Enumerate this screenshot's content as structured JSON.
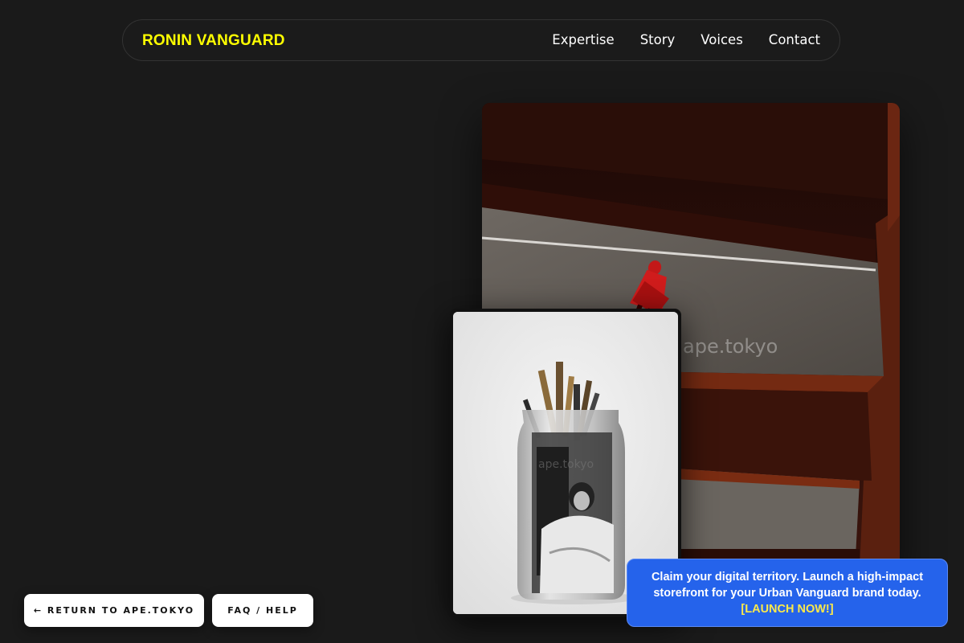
{
  "header": {
    "brand": "RONIN VANGUARD",
    "brand_color": "#ffff00",
    "nav": [
      "Expertise",
      "Story",
      "Voices",
      "Contact"
    ]
  },
  "gallery": {
    "main_photo_watermark": "ape.tokyo",
    "small_photo_watermark": "ape.tokyo"
  },
  "buttons": {
    "return_label": "← RETURN TO APE.TOKYO",
    "faq_label": "FAQ / HELP"
  },
  "promo": {
    "text": "Claim your digital territory. Launch a high-impact storefront for your Urban Vanguard brand today.",
    "cta": "[LAUNCH NOW!]",
    "background": "#2563eb",
    "cta_color": "#fbe94a"
  }
}
